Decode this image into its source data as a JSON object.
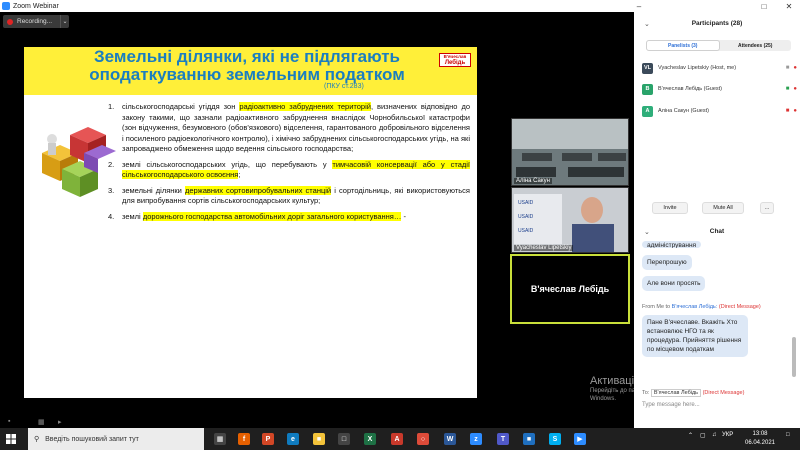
{
  "window": {
    "title": "Zoom Webinar"
  },
  "recording": {
    "label": "Recording..."
  },
  "slide": {
    "title_line1": "Земельні ділянки, які не підлягають",
    "title_line2": "оподаткуванню земельним податком",
    "subtitle": "(ПКУ ст.283)",
    "logo_line1": "В'ячеслав",
    "logo_line2": "Лебідь",
    "items": [
      {
        "num": "1.",
        "parts": [
          "сільськогосподарські угіддя зон ",
          "радіоактивно забруднених територій",
          ", визначених відповідно до закону такими, що зазнали радіоактивного забруднення внаслідок Чорнобильської катастрофи (зон відчуження, безумовного (обов'язкового) відселення, гарантованого добровільного відселення і посиленого радіоекологічного контролю), і хімічно забруднених сільськогосподарських угідь, на які запроваджено обмеження щодо ведення сільського господарства;"
        ]
      },
      {
        "num": "2.",
        "parts": [
          "землі сільськогосподарських угідь, що перебувають у ",
          "тимчасовій консервації або у стадії сільськогосподарського освоєння",
          ";"
        ]
      },
      {
        "num": "3.",
        "parts": [
          "земельні ділянки ",
          "державних сортовипробувальних станцій",
          " і сортодільниць, які використовуються для випробування сортів сільськогосподарських культур;"
        ]
      },
      {
        "num": "4.",
        "parts": [
          "землі ",
          "дорожнього господарства автомобільних доріг загального користування…",
          " -"
        ]
      }
    ]
  },
  "videos": {
    "tile1_name": "Аліна Сакун",
    "tile2_name": "Vyacheslav Lipetskiy",
    "tile3_name": "В'ячеслав Лебідь"
  },
  "watermark": {
    "line1": "Активація Windows",
    "line2": "Перейдіть до пар",
    "line3": "Windows."
  },
  "participants": {
    "header": "Participants (28)",
    "tab_panelists": "Panelists (3)",
    "tab_attendees": "Attendees (25)",
    "list": [
      {
        "initials": "VL",
        "name": "Vyacheslav Lipetskiy (Host, me)",
        "color": "#3b4a5a"
      },
      {
        "initials": "В",
        "name": "В'ячеслав Лебідь (Guest)",
        "color": "#29a36a"
      },
      {
        "initials": "А",
        "name": "Аліна Сакун (Guest)",
        "color": "#2fae7a"
      }
    ],
    "invite": "Invite",
    "mute_all": "Mute All",
    "more": "..."
  },
  "chat": {
    "header": "Chat",
    "partial": "адміністрування",
    "msg1": "Перепрошую",
    "msg2": "Але вони просять",
    "from_label": "From Me to",
    "from_recipient": "В'ячеслав Лебідь:",
    "from_direct": "(Direct Message)",
    "msg3": "Пане В'ячеславе. Вкажіть Хто встановлює НГО та як процедура. Прийняття рішення по місцевом податкам",
    "to_label": "To:",
    "to_select": "В'ячеслав Лебідь",
    "to_direct": "(Direct Message)",
    "input_placeholder": "Type message here..."
  },
  "taskbar": {
    "search_placeholder": "Введіть пошуковий запит тут",
    "lang": "УКР",
    "time": "13:08",
    "date": "06.04.2021"
  }
}
